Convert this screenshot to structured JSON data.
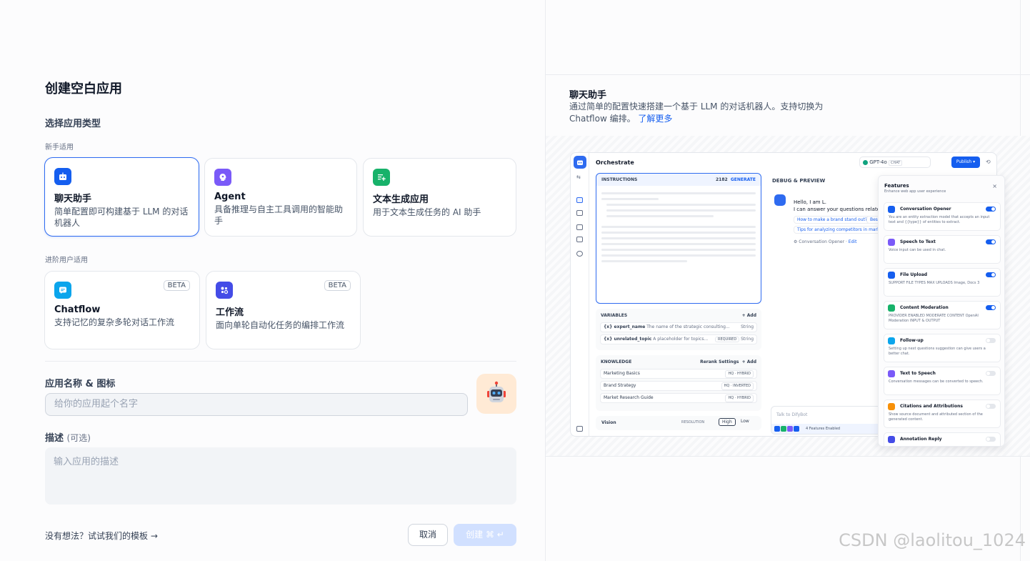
{
  "left": {
    "title": "创建空白应用",
    "select_type": "选择应用类型",
    "group_beginner": "新手适用",
    "group_advanced": "进阶用户适用",
    "types": [
      {
        "name": "聊天助手",
        "desc": "简单配置即可构建基于 LLM 的对话机器人",
        "color": "#155eef"
      },
      {
        "name": "Agent",
        "desc": "具备推理与自主工具调用的智能助手",
        "color": "#7a5af8"
      },
      {
        "name": "文本生成应用",
        "desc": "用于文本生成任务的 AI 助手",
        "color": "#17b26a"
      },
      {
        "name": "Chatflow",
        "desc": "支持记忆的复杂多轮对话工作流",
        "color": "#0ba5ec",
        "badge": "BETA"
      },
      {
        "name": "工作流",
        "desc": "面向单轮自动化任务的编排工作流",
        "color": "#444ce7",
        "badge": "BETA"
      }
    ],
    "name_label": "应用名称 & 图标",
    "name_placeholder": "给你的应用起个名字",
    "desc_label": "描述",
    "desc_optional": "(可选)",
    "desc_placeholder": "输入应用的描述",
    "template_link": "没有想法？试试我们的模板 →",
    "cancel": "取消",
    "create": "创建 ⌘ ↵"
  },
  "right": {
    "title": "聊天助手",
    "desc": "通过简单的配置快速搭建一个基于 LLM 的对话机器人。支持切换为 Chatflow 编排。",
    "learn_more": "了解更多",
    "preview": {
      "orchestrate": "Orchestrate",
      "model": "GPT-4o",
      "model_tag": "CHAT",
      "publish": "Publish",
      "instructions": "INSTRUCTIONS",
      "instructions_count": "2182",
      "generate": "GENERATE",
      "variables": "VARIABLES",
      "add": "+ Add",
      "variable_rows": [
        {
          "name": "{x} expert_name",
          "desc": "The name of the strategic consulting...",
          "type": "String"
        },
        {
          "name": "{x} unrelated_topic",
          "desc": "A placeholder for topics...",
          "tag": "REQUIRED",
          "type": "String"
        }
      ],
      "knowledge": "KNOWLEDGE",
      "rerank": "Rerank Settings",
      "knowledge_rows": [
        {
          "name": "Marketing Basics",
          "tag": "HQ · HYBRID"
        },
        {
          "name": "Brand Strategy",
          "tag": "HQ · INVERTED"
        },
        {
          "name": "Market Research Guide",
          "tag": "HQ · HYBRID"
        }
      ],
      "vision": "Vision",
      "resolution": "RESOLUTION",
      "high": "High",
      "low": "Low",
      "debug": "DEBUG & PREVIEW",
      "greeting1": "Hello, I am L.",
      "greeting2": "I can answer your questions related",
      "sugg1": "How to make a brand stand out?",
      "sugg1b": "Bes",
      "sugg2": "Tips for analyzing competitors in market",
      "opener": "Conversation Opener",
      "edit": "Edit",
      "talk_placeholder": "Talk to DifyBot",
      "features_enabled": "4 Features Enabled"
    },
    "features": {
      "title": "Features",
      "subtitle": "Enhance web app user experience",
      "close": "×",
      "items": [
        {
          "name": "Conversation Opener",
          "desc": "You are an entity extraction model that accepts an input text and {{type}} of entities to extract.",
          "on": true,
          "color": "#155eef"
        },
        {
          "name": "Speech to Text",
          "desc": "Voice input can be used in chat.",
          "on": true,
          "color": "#7a5af8"
        },
        {
          "name": "File Upload",
          "desc": "SUPPORT FILE TYPES   MAX UPLOADS  Image, Docs   3",
          "on": true,
          "color": "#155eef"
        },
        {
          "name": "Content Moderation",
          "desc": "PROVIDER   ENABLED MODERATE CONTENT  OpenAI Moderation   INPUT & OUTPUT",
          "on": true,
          "color": "#17b26a"
        },
        {
          "name": "Follow-up",
          "desc": "Setting up next questions suggestion can give users a better chat.",
          "on": false,
          "color": "#0ba5ec"
        },
        {
          "name": "Text to Speech",
          "desc": "Conversation messages can be converted to speech.",
          "on": false,
          "color": "#7a5af8"
        },
        {
          "name": "Citations and Attributions",
          "desc": "Show source document and attributed section of the generated content.",
          "on": false,
          "color": "#f79009"
        },
        {
          "name": "Annotation Reply",
          "desc": "",
          "on": false,
          "color": "#444ce7"
        }
      ]
    }
  },
  "watermark": "CSDN @laolitou_1024"
}
